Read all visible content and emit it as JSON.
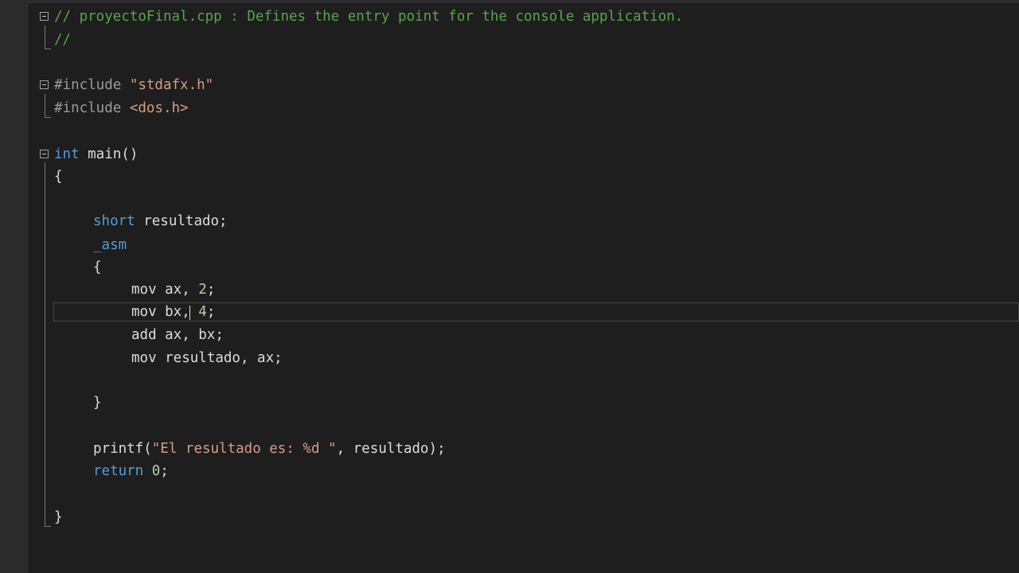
{
  "code_lines": {
    "l1": "// proyectoFinal.cpp : Defines the entry point for the console application.",
    "l2": "//",
    "l4_pp": "#include ",
    "l4_str": "\"stdafx.h\"",
    "l5_pp": "#include ",
    "l5_str": "<dos.h>",
    "l7_kw": "int",
    "l7_rest": " main()",
    "l8": "{",
    "l10_kw": "short",
    "l10_rest": " resultado;",
    "l11": "_asm",
    "l12": "{",
    "l13_a": "mov ax, ",
    "l13_num": "2",
    "l13_b": ";",
    "l14_a": "mov bx, ",
    "l14_num": "4",
    "l14_b": ";",
    "l15": "add ax, bx;",
    "l16": "mov resultado, ax;",
    "l18": "}",
    "l20_a": "printf(",
    "l20_str": "\"El resultado es: %d \"",
    "l20_b": ", resultado);",
    "l21_kw": "return",
    "l21_num": " 0",
    "l21_b": ";",
    "l23": "}"
  },
  "colors": {
    "background": "#1e1e1e",
    "comment": "#57a64a",
    "keyword": "#569cd6",
    "string": "#d69d85",
    "number": "#b5cea8",
    "text": "#dcdcdc"
  }
}
